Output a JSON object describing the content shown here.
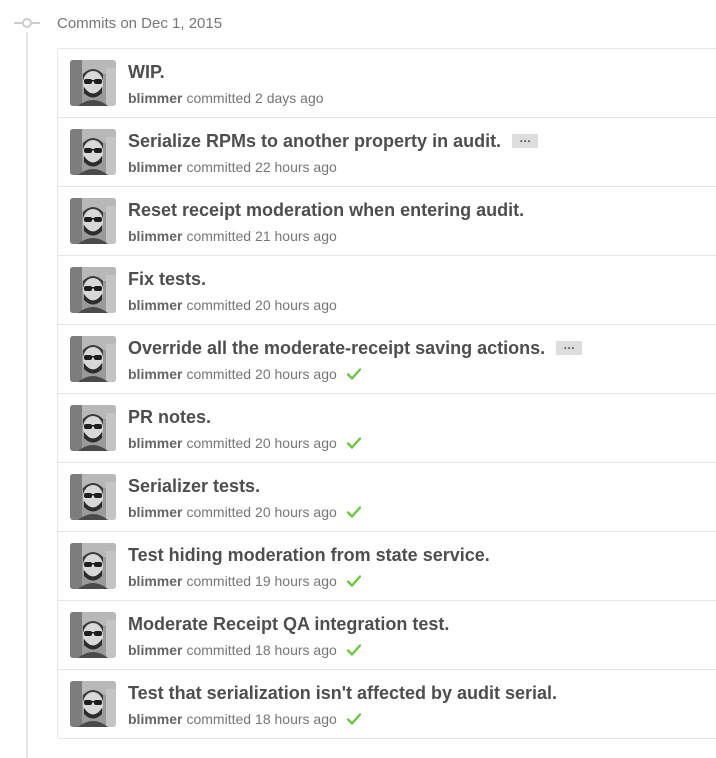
{
  "group": {
    "title": "Commits on Dec 1, 2015",
    "node_icon": "git-commit-icon"
  },
  "colors": {
    "success": "#6cc644",
    "border": "#e5e5e5",
    "title_text": "#4e4e4e",
    "meta_text": "#767676"
  },
  "commits": [
    {
      "title": "WIP.",
      "author": "blimmer",
      "action": "committed",
      "time": "2 days ago",
      "has_ellipsis": false,
      "status": "none"
    },
    {
      "title": "Serialize RPMs to another property in audit.",
      "author": "blimmer",
      "action": "committed",
      "time": "22 hours ago",
      "has_ellipsis": true,
      "status": "none"
    },
    {
      "title": "Reset receipt moderation when entering audit.",
      "author": "blimmer",
      "action": "committed",
      "time": "21 hours ago",
      "has_ellipsis": false,
      "status": "none"
    },
    {
      "title": "Fix tests.",
      "author": "blimmer",
      "action": "committed",
      "time": "20 hours ago",
      "has_ellipsis": false,
      "status": "none"
    },
    {
      "title": "Override all the moderate-receipt saving actions.",
      "author": "blimmer",
      "action": "committed",
      "time": "20 hours ago",
      "has_ellipsis": true,
      "status": "success"
    },
    {
      "title": "PR notes.",
      "author": "blimmer",
      "action": "committed",
      "time": "20 hours ago",
      "has_ellipsis": false,
      "status": "success"
    },
    {
      "title": "Serializer tests.",
      "author": "blimmer",
      "action": "committed",
      "time": "20 hours ago",
      "has_ellipsis": false,
      "status": "success"
    },
    {
      "title": "Test hiding moderation from state service.",
      "author": "blimmer",
      "action": "committed",
      "time": "19 hours ago",
      "has_ellipsis": false,
      "status": "success"
    },
    {
      "title": "Moderate Receipt QA integration test.",
      "author": "blimmer",
      "action": "committed",
      "time": "18 hours ago",
      "has_ellipsis": false,
      "status": "success"
    },
    {
      "title": "Test that serialization isn't affected by audit serial.",
      "author": "blimmer",
      "action": "committed",
      "time": "18 hours ago",
      "has_ellipsis": false,
      "status": "success"
    }
  ],
  "ellipsis_label": "…",
  "avatar_icon": "user-avatar",
  "check_icon": "check-icon"
}
